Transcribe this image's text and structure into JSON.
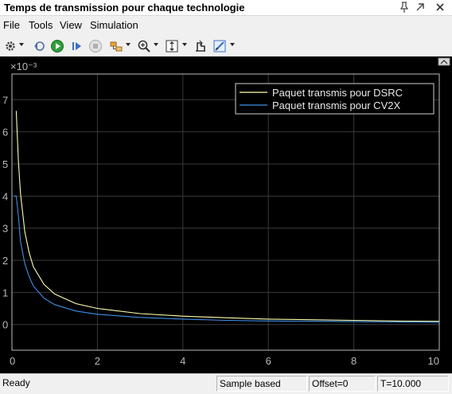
{
  "window": {
    "title": "Temps de transmission pour chaque technologie",
    "pin_icon": "pin-icon",
    "undock_icon": "undock-icon",
    "close_icon": "close-icon"
  },
  "menu": {
    "items": [
      {
        "label": "File"
      },
      {
        "label": "Tools"
      },
      {
        "label": "View"
      },
      {
        "label": "Simulation"
      }
    ]
  },
  "toolbar": {
    "icons": [
      "settings-icon",
      "step-back-icon",
      "run-icon",
      "step-forward-icon",
      "stop-icon",
      "highlight-block-icon",
      "zoom-icon",
      "autoscale-icon",
      "cursor-measure-icon",
      "style-icon"
    ]
  },
  "status": {
    "ready": "Ready",
    "mode": "Sample based",
    "offset": "Offset=0",
    "time": "T=10.000"
  },
  "colors": {
    "background": "#000000",
    "grid": "#3a3a3a",
    "axis_text": "#b8b8b8",
    "dsrc": "#ffffb0",
    "cv2x": "#3d8fe6"
  },
  "chart_data": {
    "type": "line",
    "exponent_label": "×10⁻³",
    "xlim": [
      0,
      10
    ],
    "ylim": [
      -0.0008,
      0.0078
    ],
    "xticks": [
      0,
      2,
      4,
      6,
      8,
      10
    ],
    "yticks": [
      0,
      0.001,
      0.002,
      0.003,
      0.004,
      0.005,
      0.006,
      0.007
    ],
    "ytick_labels": [
      "0",
      "1",
      "2",
      "3",
      "4",
      "5",
      "6",
      "7"
    ],
    "grid": true,
    "legend_position": "top-right",
    "series": [
      {
        "name": "Paquet transmis pour DSRC",
        "color": "#ffffb0",
        "x": [
          0.1,
          0.15,
          0.2,
          0.3,
          0.4,
          0.5,
          0.75,
          1,
          1.5,
          2,
          3,
          4,
          5,
          6,
          7,
          8,
          9,
          10
        ],
        "y": [
          0.00665,
          0.0051,
          0.0041,
          0.0029,
          0.00225,
          0.0018,
          0.00125,
          0.00095,
          0.00065,
          0.0005,
          0.00034,
          0.00026,
          0.00021,
          0.00017,
          0.00015,
          0.00013,
          0.00011,
          0.0001
        ]
      },
      {
        "name": "Paquet transmis pour CV2X",
        "color": "#3d8fe6",
        "x": [
          0.05,
          0.1,
          0.15,
          0.2,
          0.3,
          0.4,
          0.5,
          0.75,
          1,
          1.5,
          2,
          3,
          4,
          5,
          6,
          7,
          8,
          9,
          10
        ],
        "y": [
          0.004,
          0.004,
          0.0034,
          0.0026,
          0.0019,
          0.0015,
          0.0012,
          0.00082,
          0.00062,
          0.00042,
          0.00032,
          0.00022,
          0.00017,
          0.00013,
          0.00011,
          0.0001,
          9e-05,
          8e-05,
          7e-05
        ]
      }
    ]
  }
}
